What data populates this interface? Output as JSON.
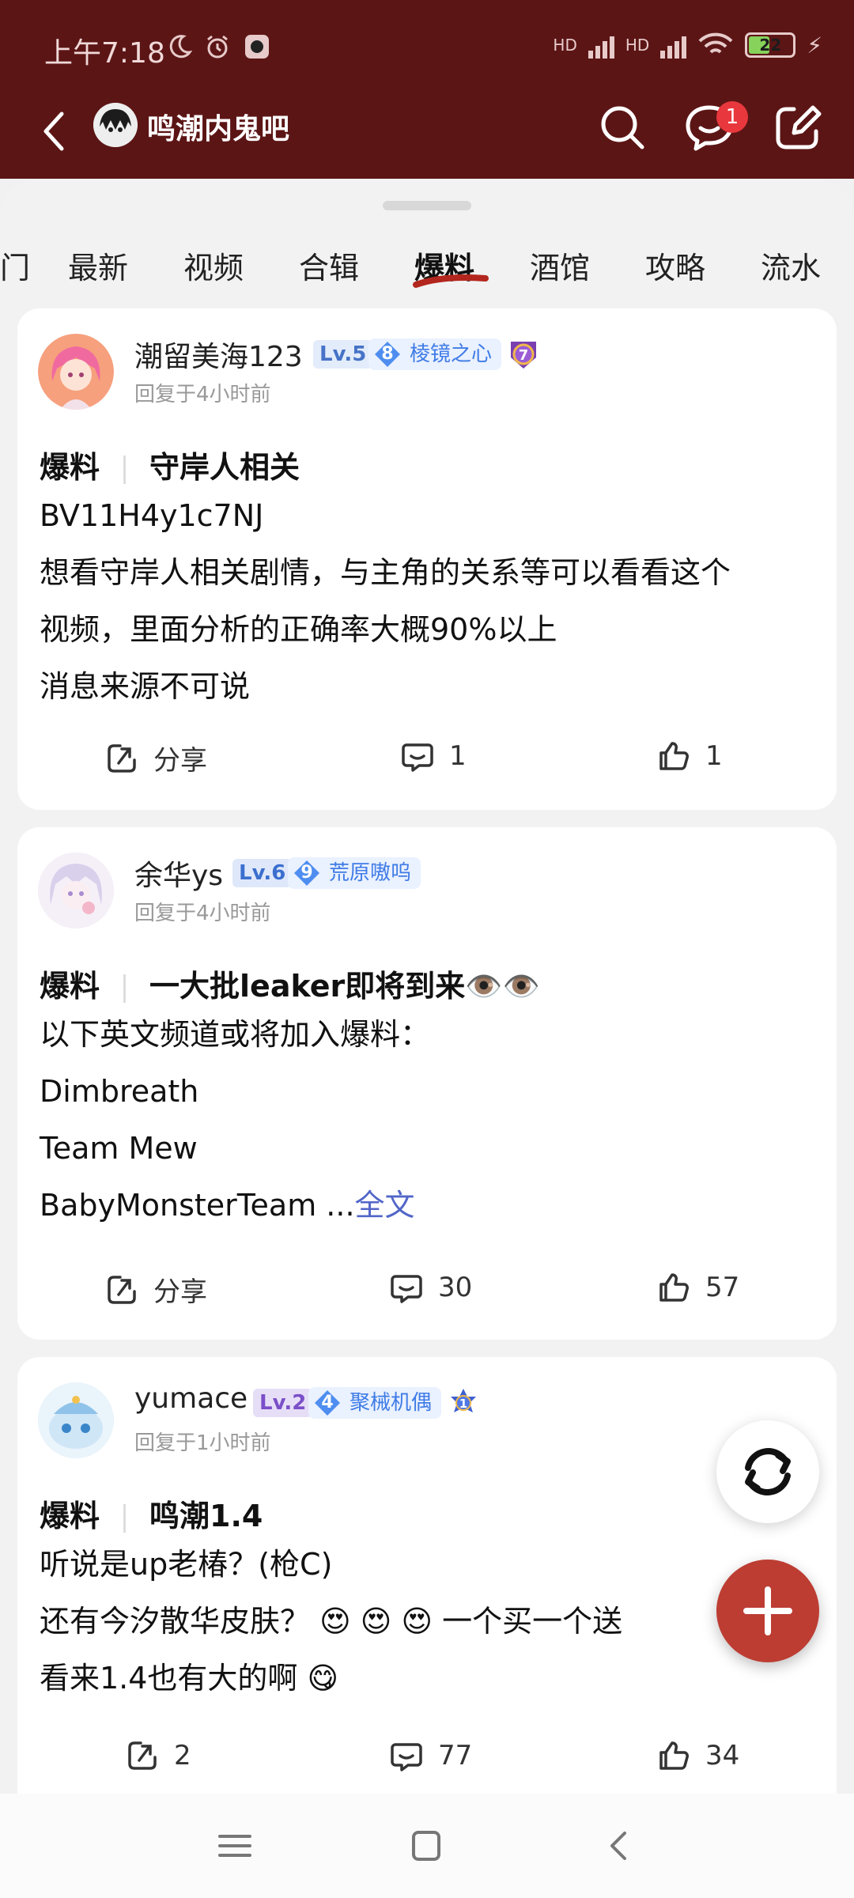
{
  "status_bar": {
    "time": "上午7:18",
    "battery": "22",
    "network_1": "HD",
    "network_2": "HD"
  },
  "header": {
    "title": "鸣潮内鬼吧",
    "message_badge": "1"
  },
  "tabs": [
    "门",
    "最新",
    "视频",
    "合辑",
    "爆料",
    "酒馆",
    "攻略",
    "流水"
  ],
  "active_tab": "爆料",
  "posts": [
    {
      "username": "潮留美海123",
      "level": "Lv.5",
      "rank_num": "8",
      "rank_title": "棱镜之心",
      "medal_num": "7",
      "time": "回复于4小时前",
      "category": "爆料",
      "title": "守岸人相关",
      "body": [
        "BV11H4y1c7NJ",
        "想看守岸人相关剧情，与主角的关系等可以看看这个",
        "视频，里面分析的正确率大概90%以上",
        "消息来源不可说"
      ],
      "share_label": "分享",
      "comments": "1",
      "likes": "1"
    },
    {
      "username": "余华ys",
      "level": "Lv.6",
      "rank_num": "9",
      "rank_title": "荒原嗷呜",
      "time": "回复于4小时前",
      "category": "爆料",
      "title": "一大批leaker即将到来👁️👁️",
      "body": [
        "以下英文频道或将加入爆料：",
        "Dimbreath",
        "Team Mew",
        "BabyMonsterTeam ..."
      ],
      "more_label": "全文",
      "share_label": "分享",
      "comments": "30",
      "likes": "57"
    },
    {
      "username": "yumace",
      "level": "Lv.2",
      "rank_num": "4",
      "rank_title": "聚械机偶",
      "medal_num": "1",
      "time": "回复于1小时前",
      "category": "爆料",
      "title": "鸣潮1.4",
      "body": [
        "听说是up老椿？(枪C)",
        "还有今汐散华皮肤？ 😍 😍 😍 一个买一个送",
        "看来1.4也有大的啊 😋"
      ],
      "shares": "2",
      "comments": "77",
      "likes": "34"
    }
  ],
  "colors": {
    "header_bg": "#5c1515",
    "accent": "#bd3d33",
    "rank_blue": "#3f7ce6",
    "link": "#5266c8"
  }
}
